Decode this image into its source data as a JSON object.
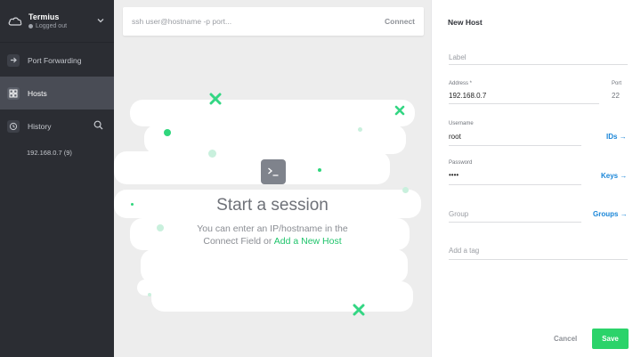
{
  "sidebar": {
    "account": {
      "name": "Termius",
      "status": "Logged out"
    },
    "items": [
      {
        "label": "Port Forwarding",
        "icon": "arrow-right-icon"
      },
      {
        "label": "Hosts",
        "icon": "grid-icon"
      },
      {
        "label": "History",
        "icon": "history-icon"
      }
    ],
    "history_entries": [
      "192.168.0.7 (9)"
    ]
  },
  "connect": {
    "placeholder": "ssh user@hostname -p port...",
    "button_label": "Connect"
  },
  "session": {
    "title": "Start a session",
    "text_line1": "You can enter an IP/hostname in the",
    "text_line2_prefix": "Connect Field or ",
    "link_label": "Add a New Host"
  },
  "panel": {
    "title": "New Host",
    "label_placeholder": "Label",
    "address_label": "Address *",
    "address_value": "192.168.0.7",
    "port_label": "Port",
    "port_value": "22",
    "username_label": "Username",
    "username_value": "root",
    "ids_link": "IDs",
    "password_label": "Password",
    "password_value": "••••",
    "keys_link": "Keys",
    "group_placeholder": "Group",
    "groups_link": "Groups",
    "tag_placeholder": "Add a tag",
    "cancel_label": "Cancel",
    "save_label": "Save"
  },
  "colors": {
    "sidebar_bg": "#2b2d33",
    "active_item_bg": "#494c55",
    "accent_green": "#2bd36a",
    "link_blue": "#1a86d8"
  }
}
